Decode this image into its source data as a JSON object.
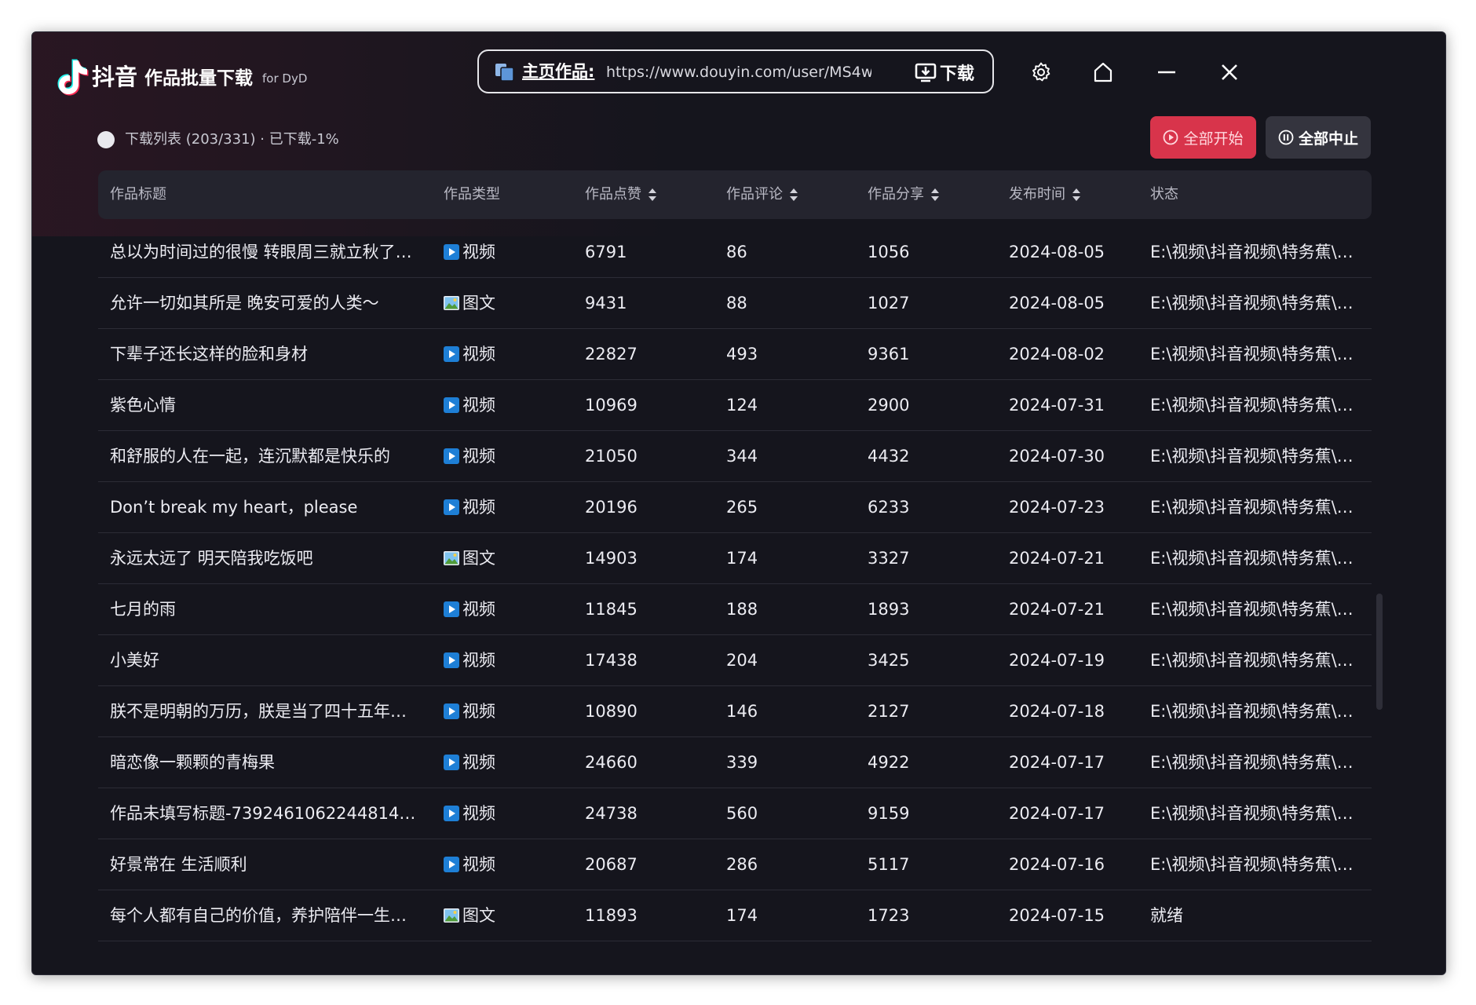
{
  "app": {
    "name": "抖音",
    "title": "作品批量下载",
    "subtitle": "for DyD"
  },
  "urlbar": {
    "label": "主页作品:",
    "value": "https://www.douyin.com/user/MS4w",
    "download_label": "下载"
  },
  "toolbar_icons": [
    "gear-icon",
    "home-icon",
    "minimize-icon",
    "close-icon"
  ],
  "status": {
    "text": "下载列表 (203/331) · 已下载-1%"
  },
  "actions": {
    "start_all": "全部开始",
    "stop_all": "全部中止"
  },
  "colors": {
    "accent": "#d8344b",
    "video_icon": "#1e7fd6",
    "background": "#15151d"
  },
  "table": {
    "headers": [
      "作品标题",
      "作品类型",
      "作品点赞",
      "作品评论",
      "作品分享",
      "发布时间",
      "状态"
    ],
    "rows": [
      {
        "title": "总以为时间过的很慢 转眼周三就立秋了…",
        "type": "视频",
        "icon": "video-icon",
        "likes": "6791",
        "comments": "86",
        "shares": "1056",
        "date": "2024-08-05",
        "status": "E:\\视频\\抖音视频\\特务蕉\\2…"
      },
      {
        "title": "允许一切如其所是 晚安可爱的人类～",
        "type": "图文",
        "icon": "image-icon",
        "likes": "9431",
        "comments": "88",
        "shares": "1027",
        "date": "2024-08-05",
        "status": "E:\\视频\\抖音视频\\特务蕉\\2…"
      },
      {
        "title": "下辈子还长这样的脸和身材",
        "type": "视频",
        "icon": "video-icon",
        "likes": "22827",
        "comments": "493",
        "shares": "9361",
        "date": "2024-08-02",
        "status": "E:\\视频\\抖音视频\\特务蕉\\2…"
      },
      {
        "title": "紫色心情",
        "type": "视频",
        "icon": "video-icon",
        "likes": "10969",
        "comments": "124",
        "shares": "2900",
        "date": "2024-07-31",
        "status": "E:\\视频\\抖音视频\\特务蕉\\2…"
      },
      {
        "title": "和舒服的人在一起，连沉默都是快乐的",
        "type": "视频",
        "icon": "video-icon",
        "likes": "21050",
        "comments": "344",
        "shares": "4432",
        "date": "2024-07-30",
        "status": "E:\\视频\\抖音视频\\特务蕉\\2…"
      },
      {
        "title": "Don’t break my heart，please",
        "type": "视频",
        "icon": "video-icon",
        "likes": "20196",
        "comments": "265",
        "shares": "6233",
        "date": "2024-07-23",
        "status": "E:\\视频\\抖音视频\\特务蕉\\2…"
      },
      {
        "title": "永远太远了 明天陪我吃饭吧",
        "type": "图文",
        "icon": "image-icon",
        "likes": "14903",
        "comments": "174",
        "shares": "3327",
        "date": "2024-07-21",
        "status": "E:\\视频\\抖音视频\\特务蕉\\2…"
      },
      {
        "title": "七月的雨",
        "type": "视频",
        "icon": "video-icon",
        "likes": "11845",
        "comments": "188",
        "shares": "1893",
        "date": "2024-07-21",
        "status": "E:\\视频\\抖音视频\\特务蕉\\2…"
      },
      {
        "title": "小美好",
        "type": "视频",
        "icon": "video-icon",
        "likes": "17438",
        "comments": "204",
        "shares": "3425",
        "date": "2024-07-19",
        "status": "E:\\视频\\抖音视频\\特务蕉\\2…"
      },
      {
        "title": "朕不是明朝的万历，朕是当了四十五年…",
        "type": "视频",
        "icon": "video-icon",
        "likes": "10890",
        "comments": "146",
        "shares": "2127",
        "date": "2024-07-18",
        "status": "E:\\视频\\抖音视频\\特务蕉\\2…"
      },
      {
        "title": "暗恋像一颗颗的青梅果",
        "type": "视频",
        "icon": "video-icon",
        "likes": "24660",
        "comments": "339",
        "shares": "4922",
        "date": "2024-07-17",
        "status": "E:\\视频\\抖音视频\\特务蕉\\2…"
      },
      {
        "title": "作品未填写标题-7392461062244814…",
        "type": "视频",
        "icon": "video-icon",
        "likes": "24738",
        "comments": "560",
        "shares": "9159",
        "date": "2024-07-17",
        "status": "E:\\视频\\抖音视频\\特务蕉\\2…"
      },
      {
        "title": "好景常在 生活顺利",
        "type": "视频",
        "icon": "video-icon",
        "likes": "20687",
        "comments": "286",
        "shares": "5117",
        "date": "2024-07-16",
        "status": "E:\\视频\\抖音视频\\特务蕉\\2…"
      },
      {
        "title": "每个人都有自己的价值，养护陪伴一生…",
        "type": "图文",
        "icon": "image-icon",
        "likes": "11893",
        "comments": "174",
        "shares": "1723",
        "date": "2024-07-15",
        "status": "就绪"
      }
    ]
  }
}
